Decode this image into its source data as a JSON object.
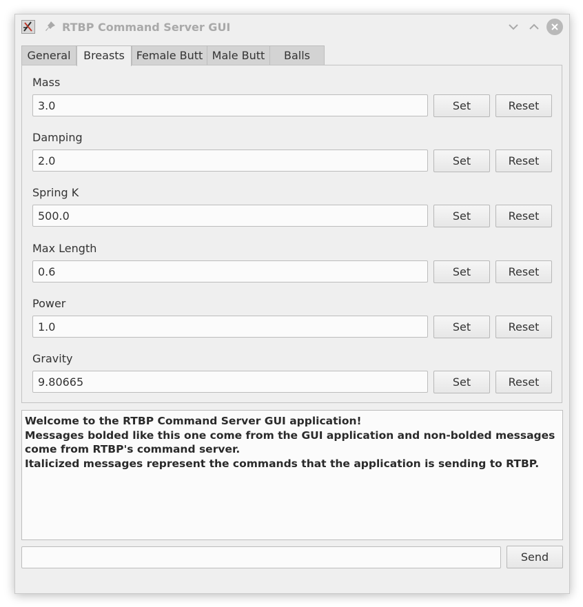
{
  "window": {
    "title": "RTBP Command Server GUI"
  },
  "tabs": [
    {
      "label": "General",
      "active": false
    },
    {
      "label": "Breasts",
      "active": true
    },
    {
      "label": "Female Butt",
      "active": false
    },
    {
      "label": "Male Butt",
      "active": false
    },
    {
      "label": "Balls",
      "active": false
    }
  ],
  "fields": [
    {
      "label": "Mass",
      "value": "3.0"
    },
    {
      "label": "Damping",
      "value": "2.0"
    },
    {
      "label": "Spring K",
      "value": "500.0"
    },
    {
      "label": "Max Length",
      "value": "0.6"
    },
    {
      "label": "Power",
      "value": "1.0"
    },
    {
      "label": "Gravity",
      "value": "9.80665"
    }
  ],
  "buttons": {
    "set_label": "Set",
    "reset_label": "Reset",
    "send_label": "Send"
  },
  "log": {
    "messages": [
      "Welcome to the RTBP Command Server GUI application!",
      "Messages bolded like this one come from the GUI application and non-bolded messages come from RTBP's command server.",
      "Italicized messages represent the commands that the application is sending to RTBP."
    ]
  },
  "command": {
    "value": "",
    "placeholder": ""
  },
  "icons": {
    "app": "app-icon",
    "pin": "pin-icon",
    "minimize": "chevron-down-icon",
    "maximize": "chevron-up-icon",
    "close": "close-icon"
  }
}
